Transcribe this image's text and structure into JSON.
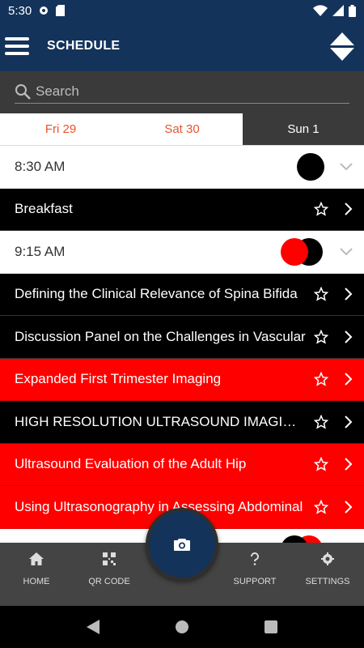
{
  "status": {
    "time": "5:30"
  },
  "app_bar": {
    "title": "SCHEDULE"
  },
  "search": {
    "placeholder": "Search"
  },
  "day_tabs": [
    {
      "label": "Fri 29",
      "active": false
    },
    {
      "label": "Sat 30",
      "active": false
    },
    {
      "label": "Sun 1",
      "active": true
    }
  ],
  "schedule": {
    "time_1": "8:30 AM",
    "time_2": "9:15 AM",
    "sessions": [
      {
        "title": "Breakfast",
        "color": "#000000"
      },
      {
        "title": "Defining the Clinical Relevance of Spina Bifida",
        "color": "#000000"
      },
      {
        "title": "Discussion Panel on the Challenges in Vascular",
        "color": "#000000"
      },
      {
        "title": "Expanded First Trimester Imaging",
        "color": "#ff0000"
      },
      {
        "title": "HIGH RESOLUTION ULTRASOUND IMAGING OF",
        "color": "#000000"
      },
      {
        "title": "Ultrasound Evaluation of the Adult Hip",
        "color": "#ff0000"
      },
      {
        "title": "Using Ultrasonography in Assessing Abdominal",
        "color": "#ff0000"
      }
    ]
  },
  "bottom_nav": {
    "home": "HOME",
    "qr": "QR CODE",
    "support": "SUPPORT",
    "settings": "SETTINGS"
  },
  "colors": {
    "primary": "#13335a",
    "accent": "#e8532b",
    "red": "#ff0000"
  }
}
